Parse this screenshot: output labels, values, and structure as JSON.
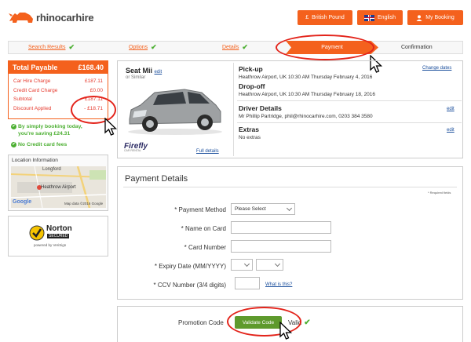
{
  "brand": {
    "name": "rhinocarhire",
    "color": "#f4611d"
  },
  "header": {
    "currency_label": "British Pound",
    "currency_symbol": "£",
    "language_label": "English",
    "account_label": "My Booking"
  },
  "steps": [
    {
      "label": "Search Results",
      "state": "done"
    },
    {
      "label": "Options",
      "state": "done"
    },
    {
      "label": "Details",
      "state": "done"
    },
    {
      "label": "Payment",
      "state": "active"
    },
    {
      "label": "Confirmation",
      "state": "pending"
    }
  ],
  "summary": {
    "total_label": "Total Payable",
    "total_value": "£168.40",
    "charges": [
      {
        "label": "Car Hire Charge",
        "value": "£187.11"
      },
      {
        "label": "Credit Card Charge",
        "value": "£0.00"
      },
      {
        "label": "Subtotal",
        "value": "£187.11"
      },
      {
        "label": "Discount Applied",
        "value": "- £18.71"
      }
    ],
    "saving_line1": "By simply booking today,",
    "saving_line2": "you're saving £24.31",
    "no_fees": "No Credit card fees"
  },
  "location": {
    "title": "Location Information",
    "map_labels": [
      "Longford",
      "Heathrow Airport"
    ],
    "map_footer": "Map data ©2016 Google",
    "google": "Google"
  },
  "norton": {
    "brand": "Norton",
    "secured": "SECURED",
    "powered": "powered by VeriSign"
  },
  "car": {
    "name": "Seat Mii",
    "edit": "edit",
    "similar": "or Similar",
    "supplier": "Firefly",
    "supplier_sub": "CAR RENTAL",
    "full_details": "Full details"
  },
  "trip": {
    "pickup_title": "Pick-up",
    "pickup_text": "Heathrow Airport, UK 10:30 AM Thursday February 4, 2016",
    "change_dates": "Change dates",
    "dropoff_title": "Drop-off",
    "dropoff_text": "Heathrow Airport, UK 10:30 AM Thursday February 18, 2016",
    "driver_title": "Driver Details",
    "driver_text": "Mr Phillip Partridge, phil@rhinocarhire.com, 0203 384 3580",
    "extras_title": "Extras",
    "extras_text": "No extras",
    "edit": "edit"
  },
  "payment": {
    "title": "Payment Details",
    "required_note": "* Required fields",
    "method_label": "* Payment Method",
    "method_value": "Please Select",
    "name_label": "* Name on Card",
    "number_label": "* Card Number",
    "expiry_label": "* Expiry Date (MM/YYYY)",
    "ccv_label": "* CCV Number  (3/4 digits)",
    "ccv_help": "What is this?"
  },
  "promo": {
    "label": "Promotion Code",
    "button": "Validate Code",
    "status": "Valid"
  }
}
